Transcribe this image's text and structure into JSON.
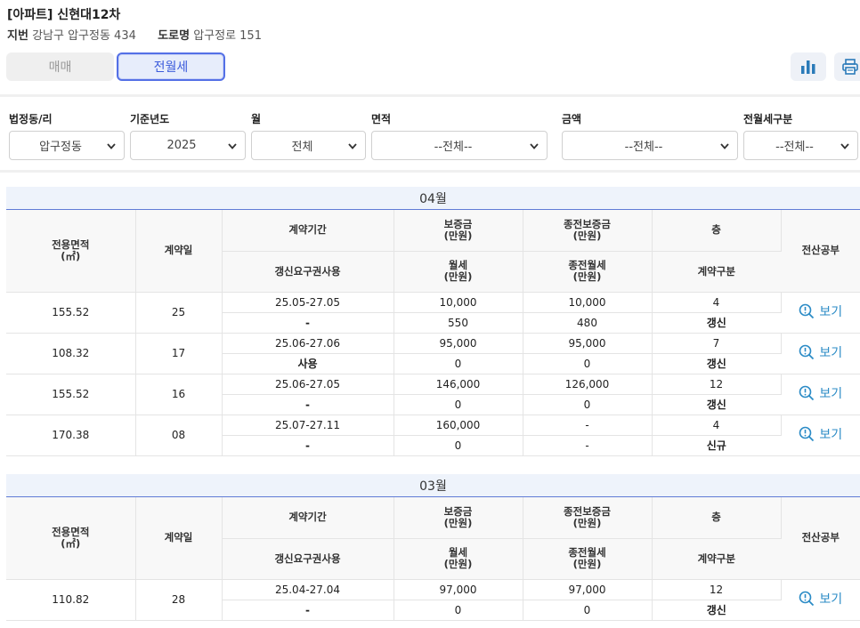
{
  "apartment": {
    "title": "[아파트] 신현대12차",
    "jibun_label": "지번",
    "jibun_value": "강남구 압구정동 434",
    "road_label": "도로명",
    "road_value": "압구정로 151"
  },
  "tabs": {
    "sale": "매매",
    "rent": "전월세",
    "active": "rent"
  },
  "filters": {
    "dong_label": "법정동/리",
    "dong_value": "압구정동",
    "year_label": "기준년도",
    "year_value": "2025",
    "month_label": "월",
    "month_value": "전체",
    "area_label": "면적",
    "area_value": "--전체--",
    "amount_label": "금액",
    "amount_value": "--전체--",
    "type_label": "전월세구분",
    "type_value": "--전체--"
  },
  "headers": {
    "area": "전용면적\n(㎡)",
    "day": "계약일",
    "period": "계약기간",
    "deposit": "보증금\n(만원)",
    "prev_deposit": "종전보증금\n(만원)",
    "floor": "층",
    "registry": "전산공부",
    "renewal": "갱신요구권사용",
    "monthly": "월세\n(만원)",
    "prev_monthly": "종전월세\n(만원)",
    "contract_type": "계약구분"
  },
  "view_label": "보기",
  "months": [
    {
      "title": "04월",
      "rows": [
        {
          "area": "155.52",
          "day": "25",
          "period": "25.05-27.05",
          "deposit": "10,000",
          "prev_deposit": "10,000",
          "floor": "4",
          "renewal": "-",
          "monthly": "550",
          "prev_monthly": "480",
          "contract_type": "갱신"
        },
        {
          "area": "108.32",
          "day": "17",
          "period": "25.06-27.06",
          "deposit": "95,000",
          "prev_deposit": "95,000",
          "floor": "7",
          "renewal": "사용",
          "monthly": "0",
          "prev_monthly": "0",
          "contract_type": "갱신"
        },
        {
          "area": "155.52",
          "day": "16",
          "period": "25.06-27.05",
          "deposit": "146,000",
          "prev_deposit": "126,000",
          "floor": "12",
          "renewal": "-",
          "monthly": "0",
          "prev_monthly": "0",
          "contract_type": "갱신"
        },
        {
          "area": "170.38",
          "day": "08",
          "period": "25.07-27.11",
          "deposit": "160,000",
          "prev_deposit": "-",
          "floor": "4",
          "renewal": "-",
          "monthly": "0",
          "prev_monthly": "-",
          "contract_type": "신규"
        }
      ]
    },
    {
      "title": "03월",
      "rows": [
        {
          "area": "110.82",
          "day": "28",
          "period": "25.04-27.04",
          "deposit": "97,000",
          "prev_deposit": "97,000",
          "floor": "12",
          "renewal": "-",
          "monthly": "0",
          "prev_monthly": "0",
          "contract_type": "갱신"
        }
      ]
    }
  ],
  "colors": {
    "accent": "#5470e6",
    "link": "#2b8bc6",
    "header_bg": "#f8f8f8",
    "month_bg": "#eef3fb"
  },
  "icons": {
    "chart": "bar-chart-icon",
    "print": "printer-icon",
    "view": "search-alert-icon",
    "select": "chevron-down-icon"
  }
}
